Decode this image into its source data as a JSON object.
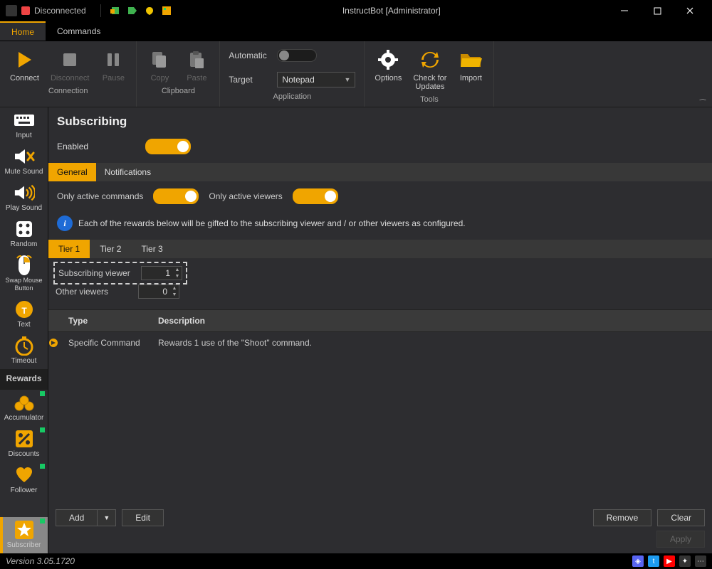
{
  "title_status": "Disconnected",
  "window_title": "InstructBot [Administrator]",
  "main_tabs": {
    "home": "Home",
    "commands": "Commands"
  },
  "ribbon": {
    "connection": {
      "connect": "Connect",
      "disconnect": "Disconnect",
      "pause": "Pause",
      "group": "Connection"
    },
    "clipboard": {
      "copy": "Copy",
      "paste": "Paste",
      "group": "Clipboard"
    },
    "application": {
      "automatic": "Automatic",
      "target": "Target",
      "target_value": "Notepad",
      "group": "Application"
    },
    "tools": {
      "options": "Options",
      "check": "Check for\nUpdates",
      "import": "Import",
      "group": "Tools"
    }
  },
  "sidebar": {
    "input": "Input",
    "mute": "Mute Sound",
    "play": "Play Sound",
    "random": "Random",
    "swap": "Swap Mouse\nButton",
    "text": "Text",
    "timeout": "Timeout",
    "rewards": "Rewards",
    "accumulator": "Accumulator",
    "discounts": "Discounts",
    "follower": "Follower",
    "subscriber": "Subscriber"
  },
  "page": {
    "title": "Subscribing",
    "enabled": "Enabled",
    "subtabs": {
      "general": "General",
      "notifications": "Notifications"
    },
    "only_cmds": "Only active commands",
    "only_viewers": "Only active viewers",
    "info": "Each of the rewards below will be gifted to the subscribing viewer and / or other viewers as configured.",
    "tiers": {
      "t1": "Tier 1",
      "t2": "Tier 2",
      "t3": "Tier 3"
    },
    "sub_viewer_lbl": "Subscribing viewer",
    "sub_viewer_val": "1",
    "other_lbl": "Other viewers",
    "other_val": "0",
    "th_type": "Type",
    "th_desc": "Description",
    "row_type": "Specific Command",
    "row_desc": "Rewards 1 use of the \"Shoot\" command.",
    "btn_add": "Add",
    "btn_edit": "Edit",
    "btn_remove": "Remove",
    "btn_clear": "Clear",
    "btn_apply": "Apply"
  },
  "status": {
    "version": "Version 3.05.1720"
  }
}
